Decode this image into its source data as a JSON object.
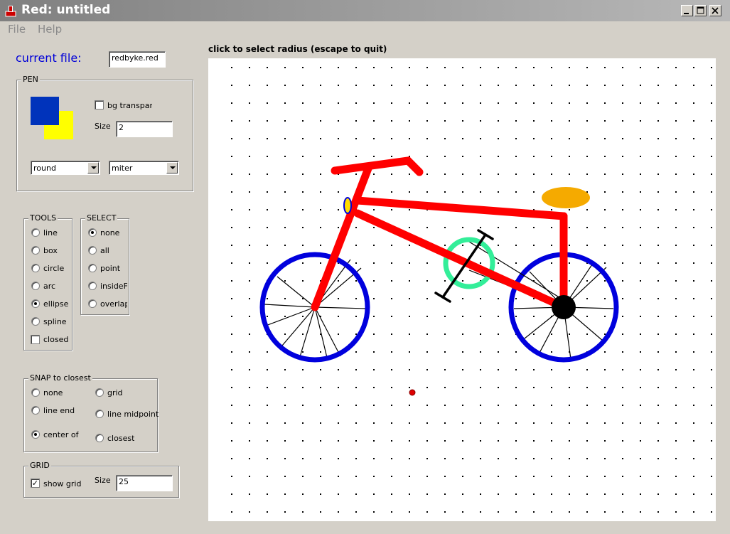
{
  "window": {
    "title": "Red: untitled",
    "controls": [
      "minimize",
      "maximize",
      "close"
    ]
  },
  "menu": [
    "File",
    "Help"
  ],
  "current_file": {
    "label": "current file:",
    "value": "redbyke.red"
  },
  "pen": {
    "title": "PEN",
    "foreground_color": "#0033bb",
    "background_color": "#ffff00",
    "bg_transparent_label": "bg transparer",
    "bg_transparent_checked": false,
    "size_label": "Size",
    "size_value": "2",
    "cap_style": "round",
    "join_style": "miter"
  },
  "tools": {
    "title": "TOOLS",
    "items": [
      {
        "label": "line",
        "selected": false
      },
      {
        "label": "box",
        "selected": false
      },
      {
        "label": "circle",
        "selected": false
      },
      {
        "label": "arc",
        "selected": false
      },
      {
        "label": "ellipse",
        "selected": true
      },
      {
        "label": "spline",
        "selected": false
      }
    ],
    "closed_label": "closed",
    "closed_checked": false
  },
  "select": {
    "title": "SELECT",
    "items": [
      {
        "label": "none",
        "selected": true
      },
      {
        "label": "all",
        "selected": false
      },
      {
        "label": "point",
        "selected": false
      },
      {
        "label": "insideF",
        "selected": false
      },
      {
        "label": "overlap",
        "selected": false
      }
    ]
  },
  "snap": {
    "title": "SNAP to closest",
    "items": [
      {
        "label": "none",
        "selected": false
      },
      {
        "label": "grid",
        "selected": false
      },
      {
        "label": "line end",
        "selected": false
      },
      {
        "label": "line midpoint",
        "selected": false
      },
      {
        "label": "center of",
        "selected": true
      },
      {
        "label": "closest",
        "selected": false
      }
    ]
  },
  "grid": {
    "title": "GRID",
    "show_label": "show grid",
    "show_checked": true,
    "size_label": "Size",
    "size_value": "25"
  },
  "status": {
    "instruction": "click to select radius (escape to quit)"
  },
  "drawing": {
    "frame_color": "#ff0000",
    "wheel_color": "#0000dd",
    "seat_color": "#f5aa00",
    "ellipse_color": "#33ee99"
  }
}
